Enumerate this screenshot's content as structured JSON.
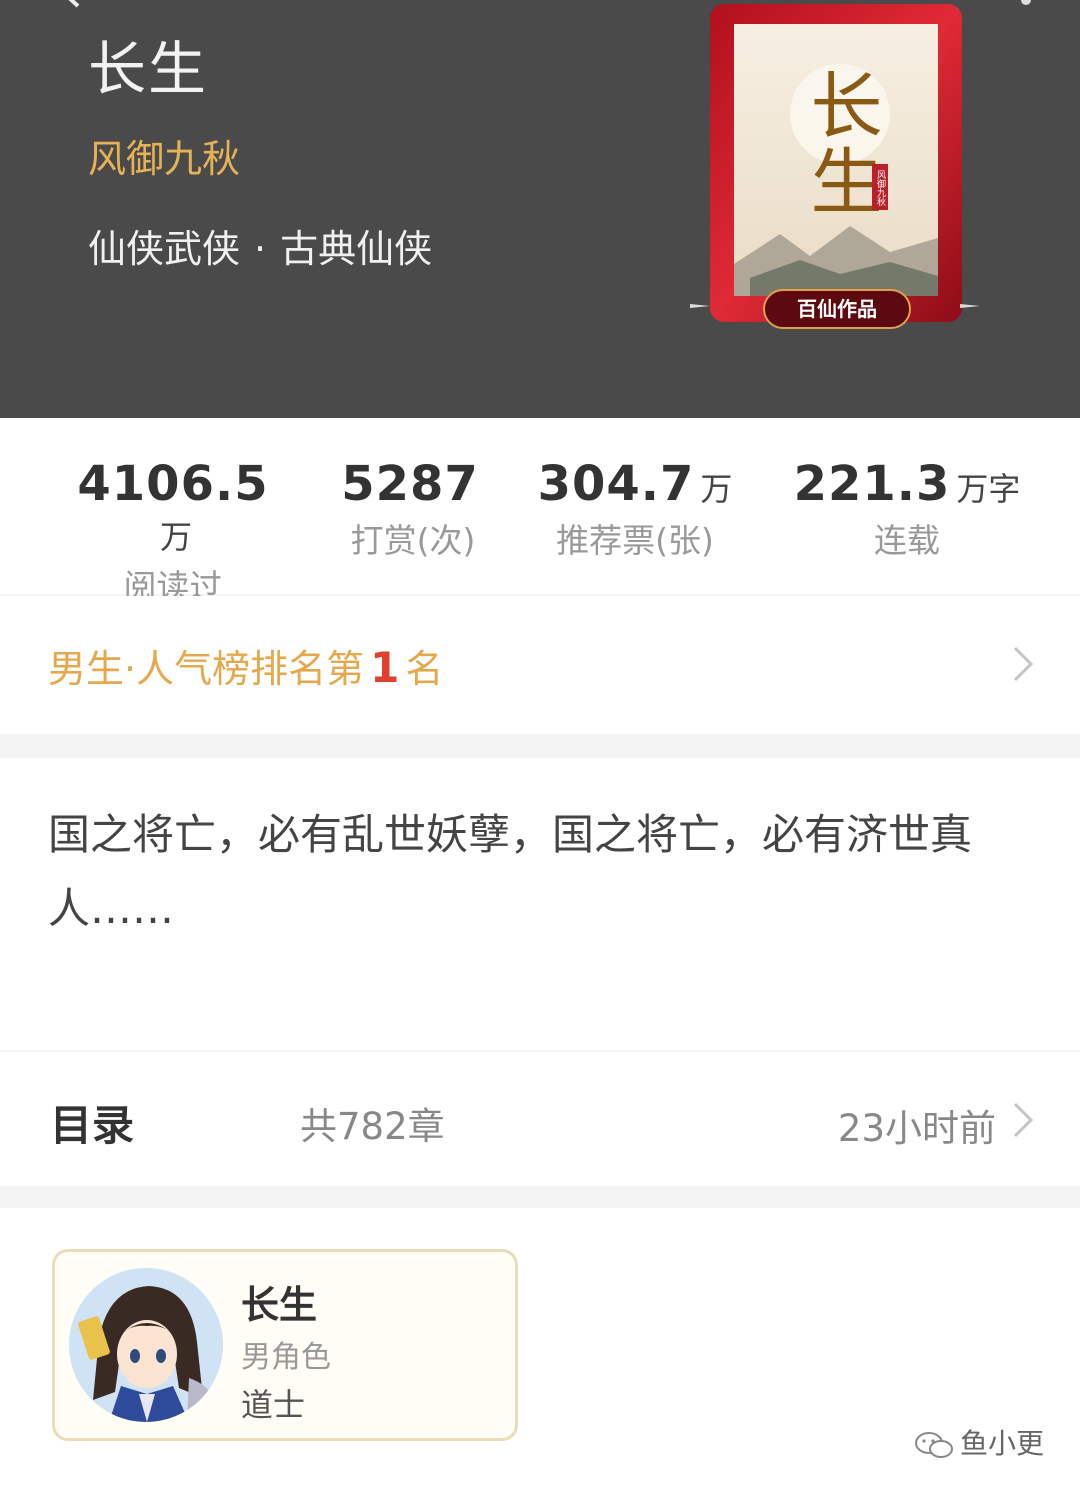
{
  "header": {
    "title": "长生",
    "author": "风御九秋",
    "genre_main": "仙侠武侠",
    "genre_dot": "·",
    "genre_sub": "古典仙侠",
    "cover": {
      "title_text": "长生",
      "author_mark": "风御九秋",
      "badge": "百仙作品"
    }
  },
  "stats": [
    {
      "value": "4106.5",
      "unit": "万",
      "label": "阅读过"
    },
    {
      "value": "5287",
      "unit": "",
      "label": "打赏(次)"
    },
    {
      "value": "304.7",
      "unit": "万",
      "label": "推荐票(张)"
    },
    {
      "value": "221.3",
      "unit": "万字",
      "label": "连载"
    }
  ],
  "rank": {
    "prefix": "男生·人气榜排名第",
    "number": "1",
    "suffix": "名"
  },
  "intro": {
    "text": "国之将亡，必有乱世妖孽，国之将亡，必有济世真人……"
  },
  "toc": {
    "title": "目录",
    "count": "共782章",
    "updated": "23小时前"
  },
  "role": {
    "name": "长生",
    "gender": "男角色",
    "desc": "道士"
  },
  "watermark": {
    "text": "鱼小更"
  },
  "colors": {
    "header_bg": "#4a4a4a",
    "author": "#e6b257",
    "rank_text": "#e6a84c",
    "rank_number": "#e0402f"
  }
}
